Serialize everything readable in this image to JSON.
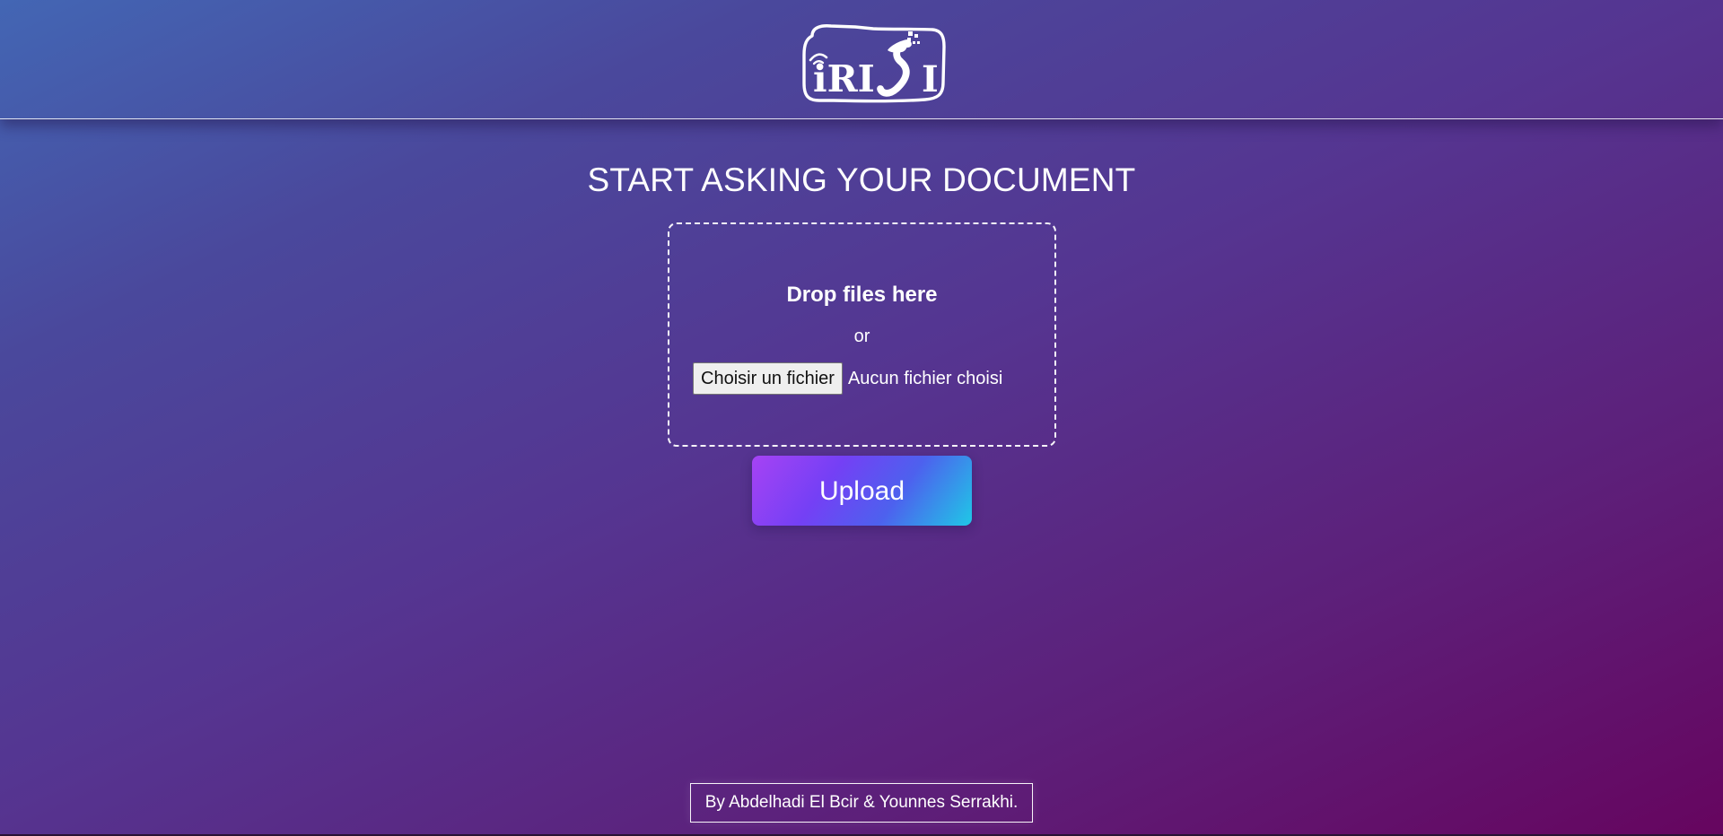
{
  "brand": {
    "logo_text": "iRISI"
  },
  "main": {
    "title": "START ASKING YOUR DOCUMENT",
    "drop_zone": {
      "heading": "Drop files here",
      "separator": "or",
      "choose_button_label": "Choisir un fichier",
      "no_file_text": "Aucun fichier choisi"
    },
    "upload_label": "Upload"
  },
  "footer": {
    "credit": "By Abdelhadi El Bcir & Younnes Serrakhi."
  },
  "colors": {
    "background_start": "#4366b4",
    "background_end": "#66055f",
    "upload_gradient_start": "#a643f4",
    "upload_gradient_end": "#1fc8e6"
  }
}
